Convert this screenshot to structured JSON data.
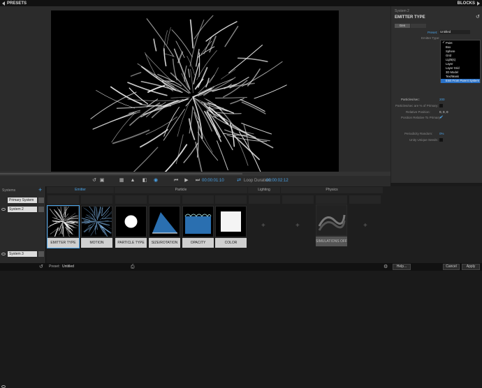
{
  "topbar": {
    "left_title": "PRESETS",
    "right_title": "BLOCKS"
  },
  "transport": {
    "current_time": "00:00:01:10",
    "loop_label": "Loop Duration:",
    "loop_time": "00:00:02:12"
  },
  "right_panel": {
    "system_label": "System 2",
    "section_title": "EMITTER TYPE",
    "tabs": [
      "Gen",
      ""
    ],
    "preset_label": "Preset:",
    "preset_value": "Untitled",
    "emitter_type_label": "Emitter Type:",
    "particles_label": "Particles/sec:",
    "particles_value": "200",
    "per_primary_label": "Particles/sec are % of Primary:",
    "relative_position_label": "Relative Position:",
    "relative_position_value": "0, 0, 0",
    "position_relative_label": "Position Relative To Primary:",
    "periodicity_label": "Periodicity Random:",
    "periodicity_value": "0%",
    "unique_seeds_label": "Unity Unique Seeds:"
  },
  "emitter_dropdown": {
    "items": [
      "Point",
      "Box",
      "Sphere",
      "Grid",
      "Light(s)",
      "Layer",
      "Layer Grid",
      "3D Model",
      "Text/Mask",
      "Emit From Parent System"
    ],
    "checked_index": 0,
    "selected_index": 9
  },
  "systems": {
    "header": "Systems",
    "rows": [
      "Primary System",
      "System 2",
      "System 3"
    ]
  },
  "columns": [
    {
      "label": "Emitter",
      "active": true
    },
    {
      "label": "Particle",
      "active": false
    },
    {
      "label": "Lighting",
      "active": false
    },
    {
      "label": "Physics",
      "active": false
    }
  ],
  "tiles": [
    {
      "label": "EMITTER TYPE"
    },
    {
      "label": "MOTION"
    },
    {
      "label": "PARTICLE TYPE"
    },
    {
      "label": "SIZE/ROTATION"
    },
    {
      "label": "OPACITY"
    },
    {
      "label": "COLOR"
    },
    {
      "label": "SIMULATIONS OFF"
    }
  ],
  "statusbar": {
    "preset_label": "Preset:",
    "preset_value": "Untitled",
    "help": "Help...",
    "cancel": "Cancel",
    "apply": "Apply"
  },
  "colors": {
    "accent": "#4aa3e8",
    "selection": "#2a72c8"
  }
}
